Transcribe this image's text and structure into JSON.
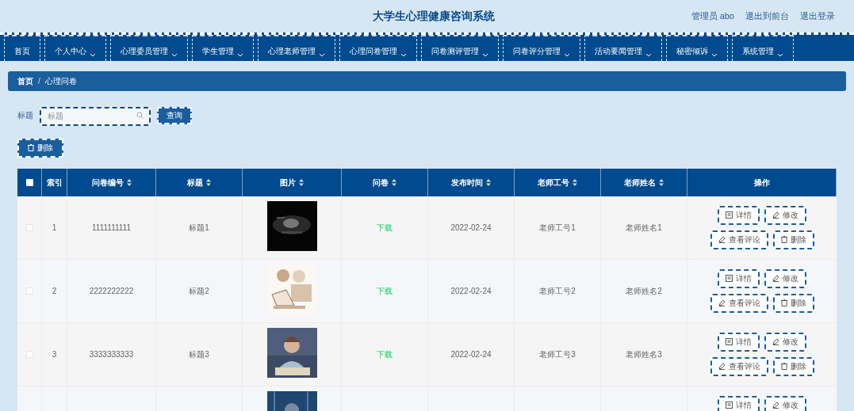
{
  "header": {
    "title": "大学生心理健康咨询系统",
    "links": [
      {
        "label": "管理员 abo"
      },
      {
        "label": "退出到前台"
      },
      {
        "label": "退出登录"
      }
    ]
  },
  "nav": [
    {
      "label": "首页",
      "dropdown": false
    },
    {
      "label": "个人中心",
      "dropdown": true
    },
    {
      "label": "心理委员管理",
      "dropdown": true
    },
    {
      "label": "学生管理",
      "dropdown": true
    },
    {
      "label": "心理老师管理",
      "dropdown": true
    },
    {
      "label": "心理问卷管理",
      "dropdown": true
    },
    {
      "label": "问卷测评管理",
      "dropdown": true
    },
    {
      "label": "问卷评分管理",
      "dropdown": true
    },
    {
      "label": "活动要闻管理",
      "dropdown": true
    },
    {
      "label": "秘密倾诉",
      "dropdown": true
    },
    {
      "label": "系统管理",
      "dropdown": true
    }
  ],
  "breadcrumb": {
    "items": [
      "首页",
      "心理问卷"
    ],
    "separator": "/"
  },
  "search": {
    "label": "标题",
    "placeholder": "标题",
    "button": "查询"
  },
  "delete_button": "删除",
  "table": {
    "select_all": {
      "checked": false
    },
    "columns": [
      {
        "label": "索引",
        "sortable": false
      },
      {
        "label": "问卷编号",
        "sortable": true
      },
      {
        "label": "标题",
        "sortable": true
      },
      {
        "label": "图片",
        "sortable": true
      },
      {
        "label": "问卷",
        "sortable": true
      },
      {
        "label": "发布时间",
        "sortable": true
      },
      {
        "label": "老师工号",
        "sortable": true
      },
      {
        "label": "老师姓名",
        "sortable": true
      },
      {
        "label": "操作",
        "sortable": false
      }
    ],
    "rows": [
      {
        "checked": false,
        "index": "1",
        "code": "1111111111",
        "title": "标题1",
        "picture": {
          "kind": "picture"
        },
        "file": "下载",
        "date": "2022-02-24",
        "teacher_id": "老师工号1",
        "teacher_name": "老师姓名1",
        "actions": [
          {
            "label": "详情",
            "kind": "detail"
          },
          {
            "label": "修改",
            "kind": "edit"
          },
          {
            "label": "查看评论",
            "kind": "comment"
          },
          {
            "label": "删除",
            "kind": "delete"
          }
        ]
      },
      {
        "checked": false,
        "index": "2",
        "code": "2222222222",
        "title": "标题2",
        "picture": {
          "kind": "picture"
        },
        "file": "下载",
        "date": "2022-02-24",
        "teacher_id": "老师工号2",
        "teacher_name": "老师姓名2",
        "actions": [
          {
            "label": "详情",
            "kind": "detail"
          },
          {
            "label": "修改",
            "kind": "edit"
          },
          {
            "label": "查看评论",
            "kind": "comment"
          },
          {
            "label": "删除",
            "kind": "delete"
          }
        ]
      },
      {
        "checked": false,
        "index": "3",
        "code": "3333333333",
        "title": "标题3",
        "picture": {
          "kind": "picture"
        },
        "file": "下载",
        "date": "2022-02-24",
        "teacher_id": "老师工号3",
        "teacher_name": "老师姓名3",
        "actions": [
          {
            "label": "详情",
            "kind": "detail"
          },
          {
            "label": "修改",
            "kind": "edit"
          },
          {
            "label": "查看评论",
            "kind": "comment"
          },
          {
            "label": "删除",
            "kind": "delete"
          }
        ]
      },
      {
        "picture": {
          "kind": "picture"
        },
        "actions": [
          {
            "label": "详情",
            "kind": "detail"
          },
          {
            "label": "修改",
            "kind": "edit"
          }
        ]
      }
    ]
  }
}
